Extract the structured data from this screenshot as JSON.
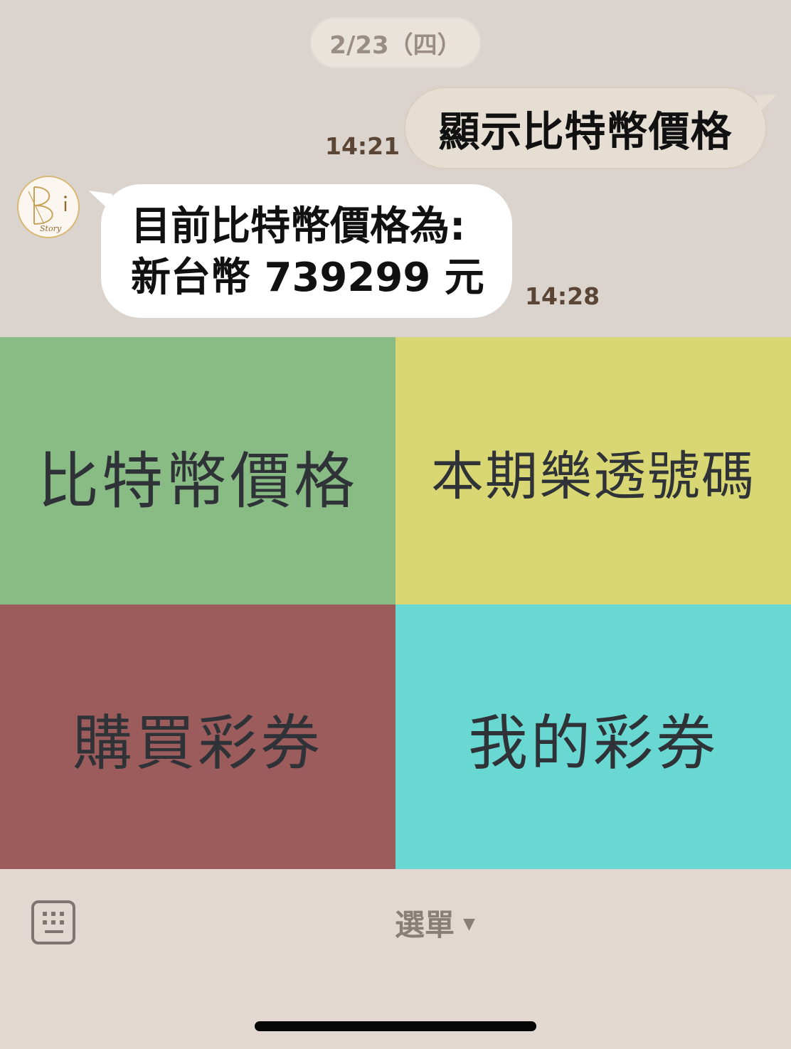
{
  "chat": {
    "date_label": "2/23（四）",
    "outgoing": {
      "text": "顯示比特幣價格",
      "time": "14:21"
    },
    "incoming": {
      "line1": "目前比特幣價格為:",
      "line2": "新台幣 739299 元",
      "time": "14:28",
      "avatar_logo_text": "Bi Story"
    }
  },
  "rich_menu": {
    "tiles": [
      {
        "label": "比特幣價格",
        "color": "#89bc84"
      },
      {
        "label": "本期樂透號碼",
        "color": "#d9d774"
      },
      {
        "label": "購買彩券",
        "color": "#9c5c5c"
      },
      {
        "label": "我的彩券",
        "color": "#6ad8d2"
      }
    ]
  },
  "bottom_bar": {
    "keyboard_icon": "keyboard-icon",
    "menu_label": "選單",
    "menu_caret_icon": "caret-down-icon"
  }
}
